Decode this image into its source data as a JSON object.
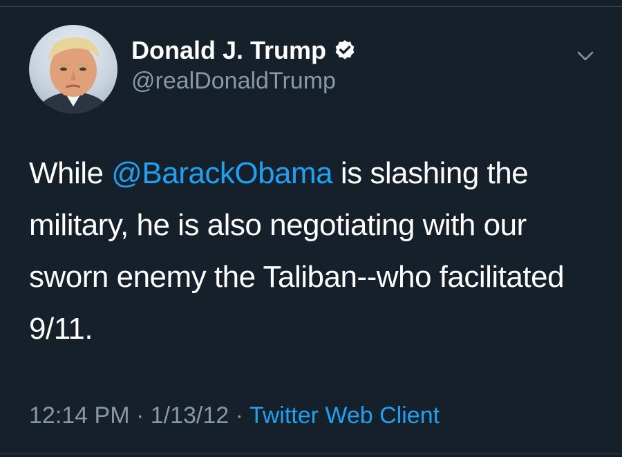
{
  "tweet": {
    "display_name": "Donald J. Trump",
    "handle": "@realDonaldTrump",
    "text_before": "While ",
    "mention": "@BarackObama",
    "text_after": " is slashing the military, he is also negotiating with our sworn enemy the Taliban--who facilitated 9/11.",
    "time": "12:14 PM",
    "separator": " · ",
    "date": "1/13/12",
    "client": "Twitter Web Client"
  },
  "icons": {
    "verified": "verified-badge-icon",
    "more": "chevron-down-icon"
  },
  "colors": {
    "background": "#15202b",
    "accent": "#1da1f2",
    "secondary_text": "#8899a6",
    "divider": "#38444d"
  }
}
